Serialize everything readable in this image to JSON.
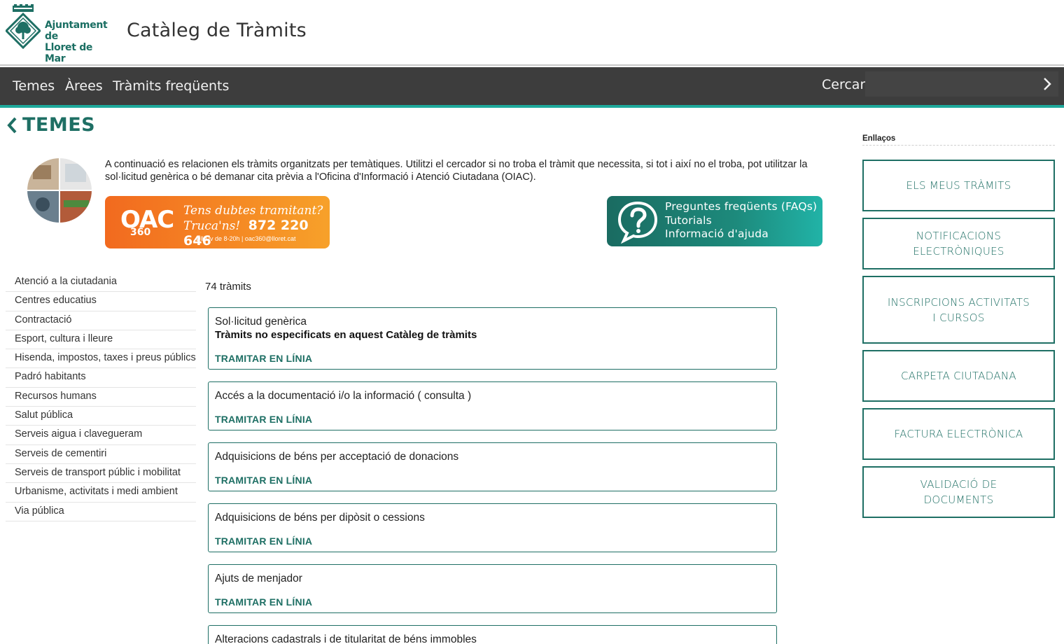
{
  "header": {
    "logo_line1": "Ajuntament de",
    "logo_line2": "Lloret de Mar",
    "site_title": "Catàleg de Tràmits"
  },
  "nav": {
    "items": [
      "Temes",
      "Àrees",
      "Tràmits freqüents"
    ],
    "search_label": "Cercar",
    "search_value": ""
  },
  "section": {
    "title": "TEMES",
    "intro": "A continuació es relacionen els tràmits organitzats per temàtiques. Utilitzi el cercador si no troba el tràmit que necessita, si tot i així no el troba, pot utilitzar la sol·licitud genèrica o bé demanar cita prèvia a l'Oficina d'Informació i Atenció Ciutadana (OIAC)."
  },
  "banners": {
    "oac": {
      "logo": "OAC",
      "logo_sub": "360",
      "line1": "Tens dubtes tramitant?",
      "line2": "Truca'ns!",
      "phone": "872 220 646",
      "line3": "Dll-Dv de 8-20h | oac360@lloret.cat"
    },
    "faq": {
      "line1": "Preguntes freqüents (FAQs)",
      "line2": "Tutorials",
      "line3": "Informació d'ajuda"
    }
  },
  "categories": [
    "Atenció a la ciutadania",
    "Centres educatius",
    "Contractació",
    "Esport, cultura i lleure",
    "Hisenda, impostos, taxes i preus públics",
    "Padró habitants",
    "Recursos humans",
    "Salut pública",
    "Serveis aigua i clavegueram",
    "Serveis de cementiri",
    "Serveis de transport públic i mobilitat",
    "Urbanisme, activitats i medi ambient",
    "Via pública"
  ],
  "count_label": "74 tràmits",
  "tramits": [
    {
      "title": "Sol·licitud genèrica",
      "subtitle": "Tràmits no especificats en aquest Catàleg de tràmits",
      "link": "TRAMITAR EN LÍNIA"
    },
    {
      "title": "Accés a la documentació i/o la informació ( consulta )",
      "link": "TRAMITAR EN LÍNIA"
    },
    {
      "title": "Adquisicions de béns per acceptació de donacions",
      "link": "TRAMITAR EN LÍNIA"
    },
    {
      "title": "Adquisicions de béns per dipòsit o cessions",
      "link": "TRAMITAR EN LÍNIA"
    },
    {
      "title": "Ajuts de menjador",
      "link": "TRAMITAR EN LÍNIA"
    },
    {
      "title": "Alteracions cadastrals i de titularitat de béns immobles"
    }
  ],
  "sidebar": {
    "title": "Enllaços",
    "links": [
      "ELS MEUS TRÀMITS",
      "NOTIFICACIONS ELECTRÒNIQUES",
      "INSCRIPCIONS ACTIVITATS I CURSOS",
      "CARPETA CIUTADANA",
      "FACTURA ELECTRÒNICA",
      "VALIDACIÓ DE DOCUMENTS"
    ]
  },
  "colors": {
    "brand_green": "#1e6f64",
    "accent_teal": "#1ea99b",
    "nav_bg": "#3d3d3d",
    "oac_orange": "#f26a1f"
  }
}
